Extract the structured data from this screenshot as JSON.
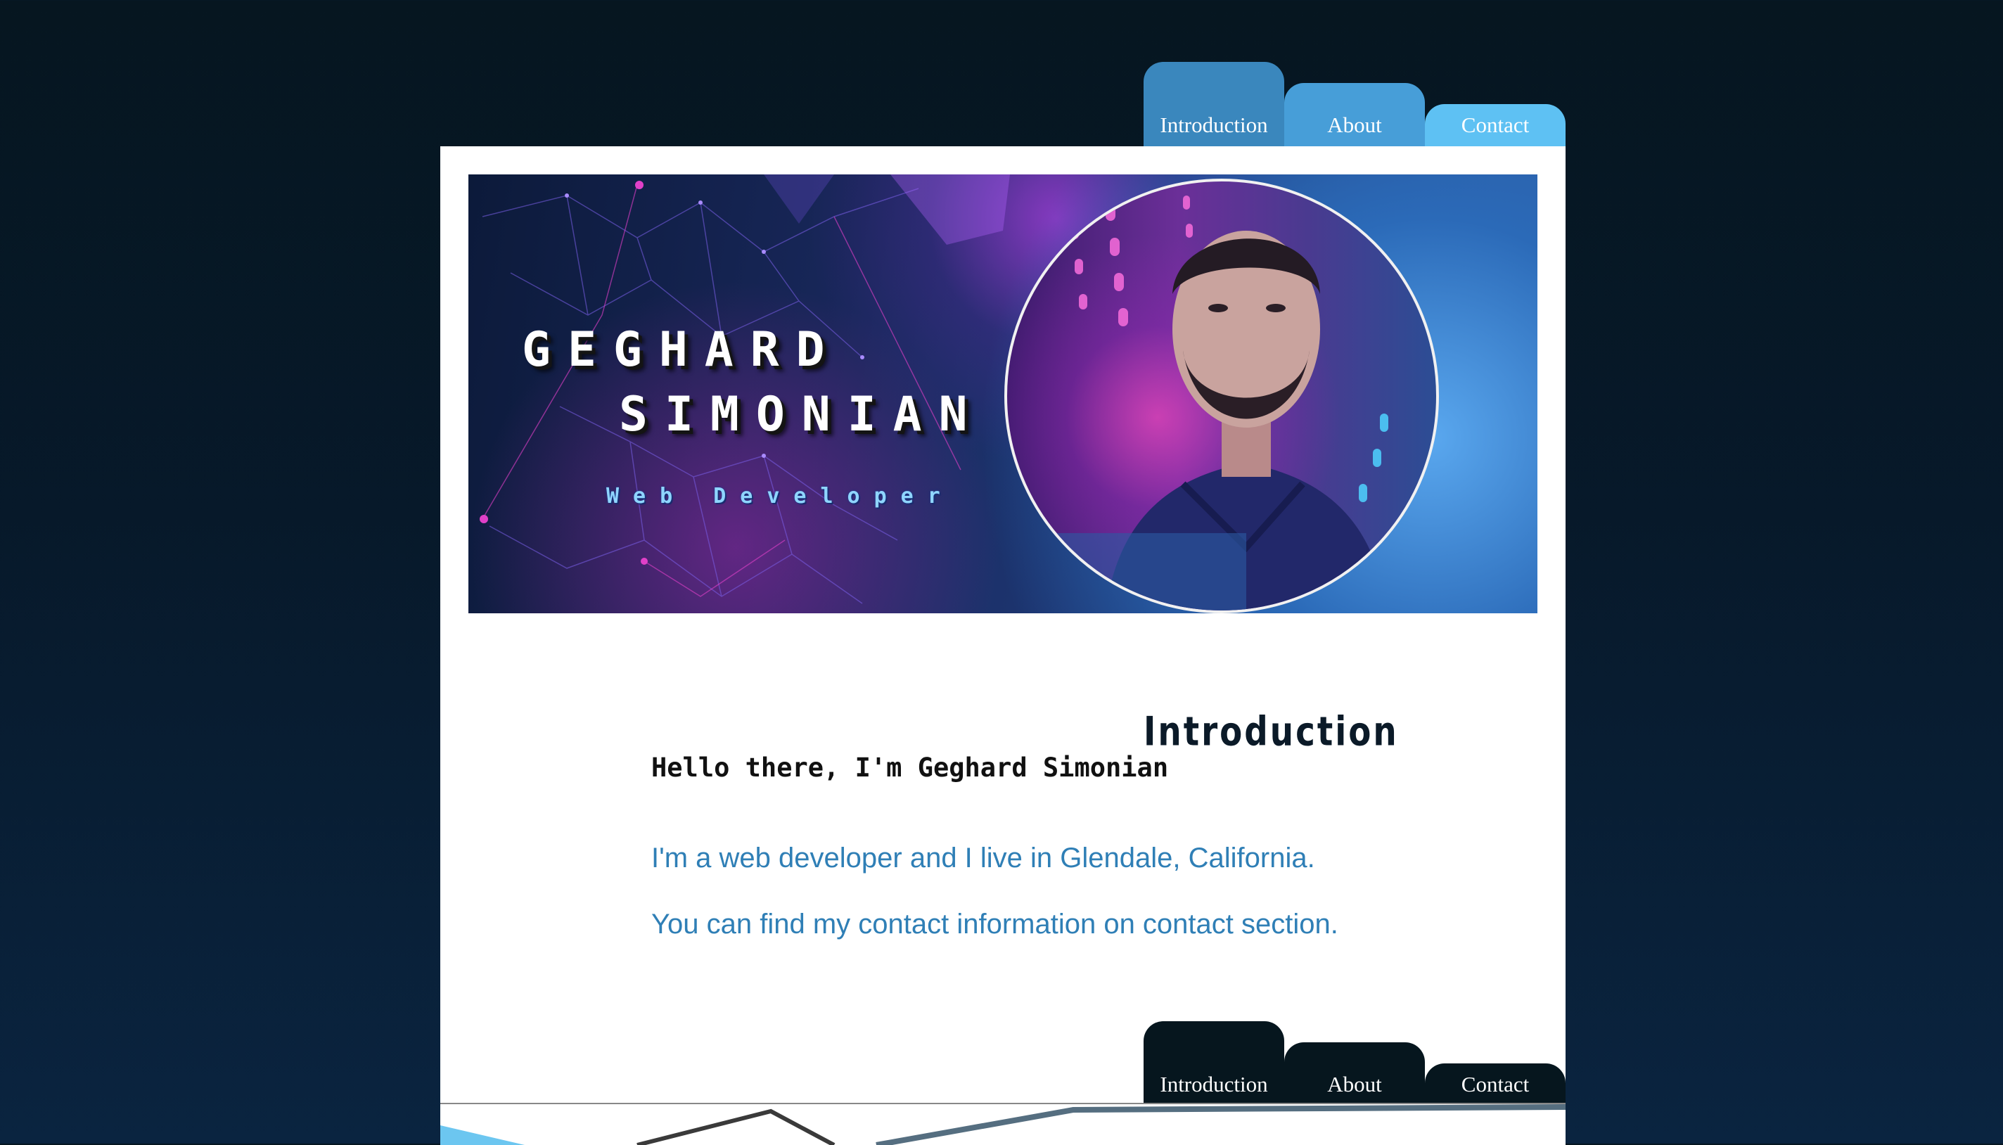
{
  "nav_top": {
    "tabs": [
      {
        "label": "Introduction"
      },
      {
        "label": "About"
      },
      {
        "label": "Contact"
      }
    ]
  },
  "banner": {
    "first_name": "GEGHARD",
    "last_name": "SIMONIAN",
    "role": "Web Developer"
  },
  "section": {
    "title": "Introduction",
    "greeting": "Hello there, I'm Geghard Simonian",
    "paragraphs": [
      "I'm a web developer and I live in Glendale, California.",
      "You can find my contact information on contact section."
    ]
  },
  "nav_bottom": {
    "tabs": [
      {
        "label": "Introduction"
      },
      {
        "label": "About"
      },
      {
        "label": "Contact"
      }
    ]
  },
  "colors": {
    "tab_intro": "#3a87bd",
    "tab_about": "#479ed8",
    "tab_contact": "#5ec1f3",
    "tab_dark": "#06161e",
    "paragraph_text": "#2f7fb6"
  }
}
